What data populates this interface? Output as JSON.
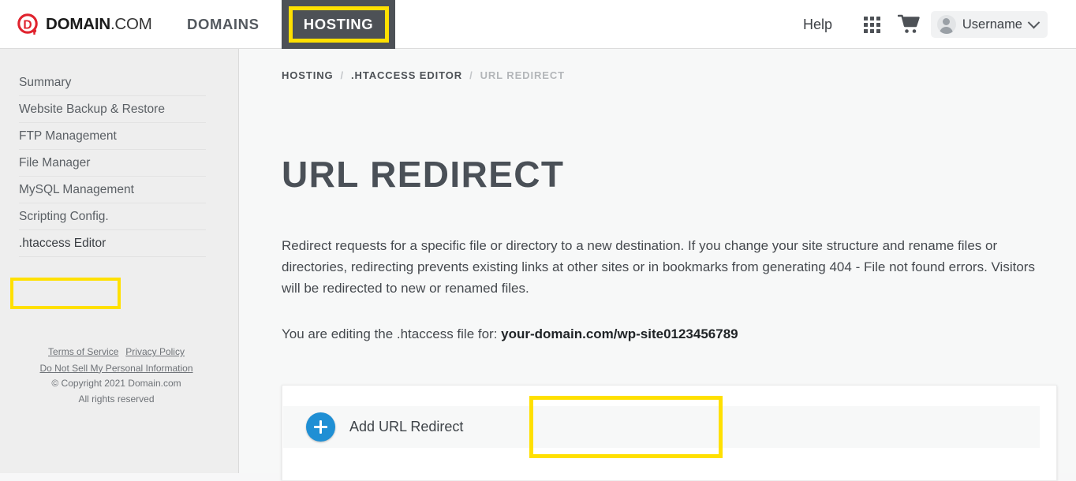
{
  "header": {
    "logo": {
      "mark": "domain-d-circle-icon",
      "bold_text": "DOMAIN",
      "light_text": ".COM"
    },
    "nav": [
      {
        "label": "DOMAINS",
        "active": false
      },
      {
        "label": "HOSTING",
        "active": true
      }
    ],
    "help_label": "Help",
    "apps_icon": "apps-grid-icon",
    "cart_icon": "shopping-cart-icon",
    "user": {
      "avatar_icon": "user-avatar-icon",
      "name": "Username",
      "chevron_icon": "chevron-down-icon"
    }
  },
  "sidebar": {
    "items": [
      {
        "label": "Summary",
        "active": false
      },
      {
        "label": "Website Backup & Restore",
        "active": false
      },
      {
        "label": "FTP Management",
        "active": false
      },
      {
        "label": "File Manager",
        "active": false
      },
      {
        "label": "MySQL Management",
        "active": false
      },
      {
        "label": "Scripting Config.",
        "active": false
      },
      {
        "label": ".htaccess Editor",
        "active": true
      }
    ],
    "footer": {
      "terms": "Terms of Service",
      "privacy": "Privacy Policy",
      "do_not_sell": "Do Not Sell My Personal Information",
      "copyright": "© Copyright 2021 Domain.com",
      "rights": "All rights reserved"
    }
  },
  "content": {
    "breadcrumb": [
      {
        "label": "HOSTING",
        "current": false
      },
      {
        "label": ".HTACCESS EDITOR",
        "current": false
      },
      {
        "label": "URL REDIRECT",
        "current": true
      }
    ],
    "breadcrumb_separator": "/",
    "title": "URL REDIRECT",
    "description": "Redirect requests for a specific file or directory to a new destination. If you change your site structure and rename files or directories, redirecting prevents existing links at other sites or in bookmarks from generating 404 - File not found errors. Visitors will be redirected to new or renamed files.",
    "editing_prefix": "You are editing the .htaccess file for: ",
    "editing_domain": "your-domain.com/wp-site0123456789",
    "add_redirect": {
      "plus_icon": "plus-icon",
      "label": "Add URL Redirect"
    }
  },
  "highlights": {
    "color": "#ffe000",
    "targets": [
      "hosting-tab",
      "htaccess-editor-sidebar-item",
      "add-url-redirect-row"
    ]
  }
}
